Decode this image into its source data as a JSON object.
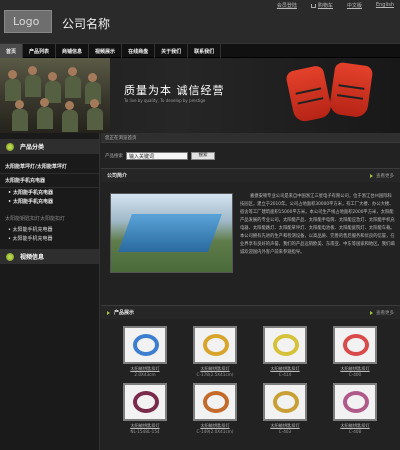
{
  "header": {
    "logo": "Logo",
    "company_name": "公司名称",
    "top_links": {
      "fav": "会员登陆",
      "cart": "购物车",
      "lang_cn": "中文版",
      "lang_en": "English"
    }
  },
  "nav": [
    "首页",
    "产品列表",
    "商铺信息",
    "视频展示",
    "在线商盘",
    "关于我们",
    "联系我们"
  ],
  "banner": {
    "slogan": "质量为本  诚信经营",
    "sub": "To live by quality, To develop by prestige"
  },
  "sidebar": {
    "category_title": "产品分类",
    "links": [
      "太阳能草坪灯/太阳能草坪灯",
      "太阳能手机充电器"
    ],
    "subs": [
      "太阳能手机充电器",
      "太阳能手机充电器"
    ],
    "gray": "太阳能钥匙扣灯太阳能扣灯",
    "subs2": [
      "太阳能手机充电器",
      "太阳能手机充电器"
    ],
    "video_title": "视频信息"
  },
  "content": {
    "breadcrumb": "您正在浏览首页",
    "search": {
      "label": "产品搜索",
      "value": "输入关键词",
      "button": "搜索"
    },
    "about": {
      "title": "公司简介",
      "more": "查看更多",
      "text": "嘉捷安顿专业公司是来自中国浙江三星电子有限公司，位于浙江台州国际科技园区，建立于2010年。公司占地面积30000平方米，有工厂大楼、办公大楼、宿舍等工厂建筑面积15000平方米。本公司生产线占地面积2000平方米，太阳能产品发展的专业公司。太阳能产品、太阳能手电筒、太阳能应急灯、太阳能手机充电器、太阳能路灯、太阳能草坪灯、太阳能电池板、太阳能庭院灯、太阳能车载。本公司拥有先进的生产和检测设备，以高品质、完善的售后服务和优良的信誉，在业界享有良好的声誉。我们的产品远销欧美、东南亚、中东等国家和地区。我们竭诚欢迎国内外客户前来参观指导。"
    },
    "products": {
      "title": "产品展示",
      "more": "查看更多",
      "items": [
        {
          "name": "太阳能钥匙扣灯",
          "code": "2.0X43cm"
        },
        {
          "name": "太阳能钥匙扣灯",
          "code": "C-178(2.5X41cm)"
        },
        {
          "name": "太阳能钥匙扣灯",
          "code": "C-414"
        },
        {
          "name": "太阳能钥匙扣灯",
          "code": "C-400"
        },
        {
          "name": "太阳能钥匙扣灯",
          "code": "NL-1548L-154"
        },
        {
          "name": "太阳能钥匙扣灯",
          "code": "C-149(2.0X41cm)"
        },
        {
          "name": "太阳能钥匙扣灯",
          "code": "C-403"
        },
        {
          "name": "太阳能钥匙扣灯",
          "code": "C-408"
        }
      ]
    }
  },
  "colors": {
    "accent": "#9bc43a",
    "background": "#222222",
    "nav_bg": "#111111",
    "nav_active": "#4c4c4c",
    "vest": "#e4412b"
  }
}
